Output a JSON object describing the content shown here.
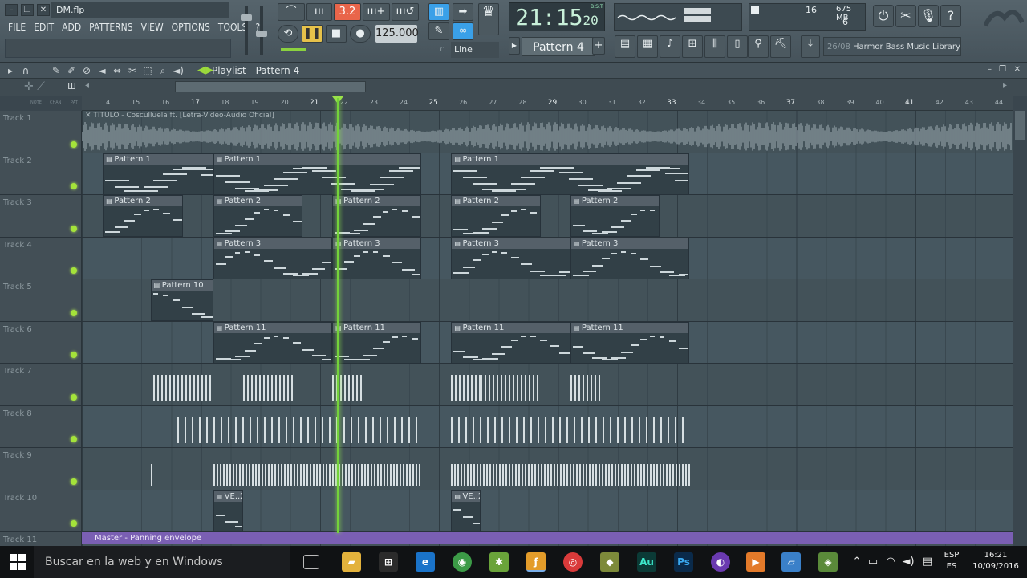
{
  "window": {
    "filename": "DM.flp"
  },
  "menu": [
    "FILE",
    "EDIT",
    "ADD",
    "PATTERNS",
    "VIEW",
    "OPTIONS",
    "TOOLS",
    "?"
  ],
  "transport": {
    "time_main": "21:15",
    "time_sub": "20",
    "time_label": "B:S:T",
    "tempo": "125.000",
    "snap": "Line",
    "pattern": "Pattern 4",
    "mode_label": "3.2"
  },
  "monitor": {
    "cpu": "16",
    "memory": "675 MB",
    "voices": "6"
  },
  "news": {
    "date": "26/08",
    "text": "Harmor Bass Music Library"
  },
  "playlist": {
    "title": "Playlist - Pattern 4",
    "ruler": [
      14,
      15,
      16,
      17,
      18,
      19,
      20,
      21,
      22,
      23,
      24,
      25,
      26,
      27,
      28,
      29,
      30,
      31,
      32,
      33,
      34,
      35,
      36,
      37,
      38,
      39,
      40,
      41,
      42,
      43,
      44
    ],
    "audio_label": "TITULO - Cosculluela ft. [Letra-Video-Audio Oficial]",
    "tracks": [
      "Track 1",
      "Track 2",
      "Track 3",
      "Track 4",
      "Track 5",
      "Track 6",
      "Track 7",
      "Track 8",
      "Track 9",
      "Track 10",
      "Track 11"
    ],
    "clips": [
      {
        "track": 1,
        "name": "Pattern 1",
        "start": 13.9,
        "end": 17.6
      },
      {
        "track": 1,
        "name": "Pattern 1",
        "start": 17.6,
        "end": 24.6
      },
      {
        "track": 1,
        "name": "Pattern 1",
        "start": 25.6,
        "end": 33.6
      },
      {
        "track": 2,
        "name": "Pattern 2",
        "start": 13.9,
        "end": 16.6
      },
      {
        "track": 2,
        "name": "Pattern 2",
        "start": 17.6,
        "end": 20.6
      },
      {
        "track": 2,
        "name": "Pattern 2",
        "start": 21.6,
        "end": 24.6
      },
      {
        "track": 2,
        "name": "Pattern 2",
        "start": 25.6,
        "end": 28.6
      },
      {
        "track": 2,
        "name": "Pattern 2",
        "start": 29.6,
        "end": 32.6
      },
      {
        "track": 3,
        "name": "Pattern 3",
        "start": 17.6,
        "end": 21.6
      },
      {
        "track": 3,
        "name": "Pattern 3",
        "start": 21.6,
        "end": 24.6
      },
      {
        "track": 3,
        "name": "Pattern 3",
        "start": 25.6,
        "end": 29.6
      },
      {
        "track": 3,
        "name": "Pattern 3",
        "start": 29.6,
        "end": 33.6
      },
      {
        "track": 4,
        "name": "Pattern 10",
        "start": 15.5,
        "end": 17.6
      },
      {
        "track": 5,
        "name": "Pattern 11",
        "start": 17.6,
        "end": 21.6
      },
      {
        "track": 5,
        "name": "Pattern 11",
        "start": 21.6,
        "end": 24.6
      },
      {
        "track": 5,
        "name": "Pattern 11",
        "start": 25.6,
        "end": 29.6
      },
      {
        "track": 5,
        "name": "Pattern 11",
        "start": 29.6,
        "end": 33.6
      },
      {
        "track": 9,
        "name": "VE..2",
        "start": 17.6,
        "end": 18.6
      },
      {
        "track": 9,
        "name": "VE..2",
        "start": 25.6,
        "end": 26.6
      }
    ],
    "playhead": 21.75,
    "master": "Master - Panning envelope"
  },
  "taskbar": {
    "search": "Buscar en la web y en Windows",
    "lang1": "ESP",
    "lang2": "ES",
    "time": "16:21",
    "date": "10/09/2016"
  },
  "colors": {
    "playhead": "#74d33a",
    "master": "#7a5fb3",
    "led": "#a4e33a"
  }
}
